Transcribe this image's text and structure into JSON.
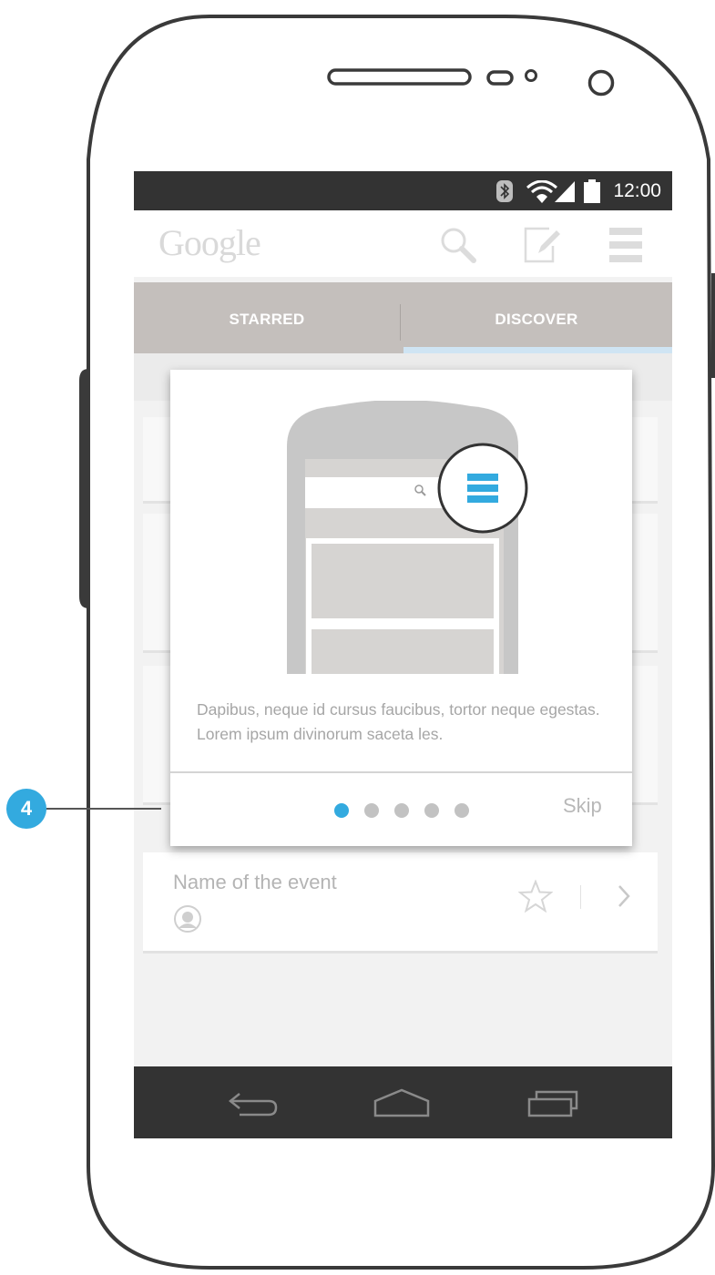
{
  "status_bar": {
    "time": "12:00",
    "icons": [
      "bluetooth-icon",
      "wifi-icon",
      "signal-icon",
      "battery-icon"
    ]
  },
  "app_bar": {
    "logo": "Google",
    "actions": [
      "search-icon",
      "compose-icon",
      "menu-icon"
    ]
  },
  "tabs": [
    {
      "label": "STARRED",
      "selected": false
    },
    {
      "label": "DISCOVER",
      "selected": true
    }
  ],
  "event_card": {
    "title": "Name of the event",
    "icons": [
      "avatar-icon",
      "star-icon",
      "chevron-right-icon"
    ]
  },
  "tutorial_dialog": {
    "description": "Dapibus, neque id cursus faucibus, tortor neque egestas. Lorem ipsum divinorum saceta les.",
    "pagination": {
      "total": 5,
      "current": 1
    },
    "skip_label": "Skip",
    "highlight_icon": "menu-icon"
  },
  "annotation": {
    "number": "4"
  },
  "nav_bar": {
    "icons": [
      "back-icon",
      "home-icon",
      "recents-icon"
    ]
  },
  "colors": {
    "accent": "#33aadf",
    "status_bar": "#333333",
    "tab_bar": "#c4bfbc"
  }
}
